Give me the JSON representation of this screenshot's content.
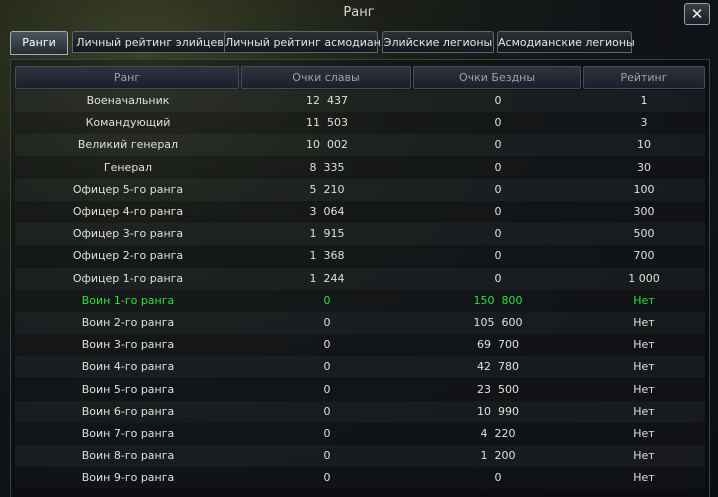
{
  "window": {
    "title": "Ранг",
    "close": "✕"
  },
  "tabs": [
    {
      "label": "Ранги",
      "active": true
    },
    {
      "label": "Личный рейтинг элийцев",
      "active": false
    },
    {
      "label": "Личный рейтинг асмодиан",
      "active": false
    },
    {
      "label": "Элийские легионы",
      "active": false
    },
    {
      "label": "Асмодианские легионы",
      "active": false
    }
  ],
  "table": {
    "headers": [
      "Ранг",
      "Очки славы",
      "Очки Бездны",
      "Рейтинг"
    ],
    "rows": [
      [
        "Военачальник",
        "12  437",
        "0",
        "1"
      ],
      [
        "Командующий",
        "11  503",
        "0",
        "3"
      ],
      [
        "Великий генерал",
        "10  002",
        "0",
        "10"
      ],
      [
        "Генерал",
        "8  335",
        "0",
        "30"
      ],
      [
        "Офицер 5-го ранга",
        "5  210",
        "0",
        "100"
      ],
      [
        "Офицер 4-го ранга",
        "3  064",
        "0",
        "300"
      ],
      [
        "Офицер 3-го ранга",
        "1  915",
        "0",
        "500"
      ],
      [
        "Офицер 2-го ранга",
        "1  368",
        "0",
        "700"
      ],
      [
        "Офицер 1-го ранга",
        "1  244",
        "0",
        "1 000"
      ],
      [
        "Воин 1-го ранга",
        "0",
        "150  800",
        "Нет"
      ],
      [
        "Воин 2-го ранга",
        "0",
        "105  600",
        "Нет"
      ],
      [
        "Воин 3-го ранга",
        "0",
        "69  700",
        "Нет"
      ],
      [
        "Воин 4-го ранга",
        "0",
        "42  780",
        "Нет"
      ],
      [
        "Воин 5-го ранга",
        "0",
        "23  500",
        "Нет"
      ],
      [
        "Воин 6-го ранга",
        "0",
        "10  990",
        "Нет"
      ],
      [
        "Воин 7-го ранга",
        "0",
        "4  220",
        "Нет"
      ],
      [
        "Воин 8-го ранга",
        "0",
        "1  200",
        "Нет"
      ],
      [
        "Воин 9-го ранга",
        "0",
        "0",
        "Нет"
      ]
    ],
    "highlighted_row": 9,
    "highlight_color": "#2ee03a"
  }
}
